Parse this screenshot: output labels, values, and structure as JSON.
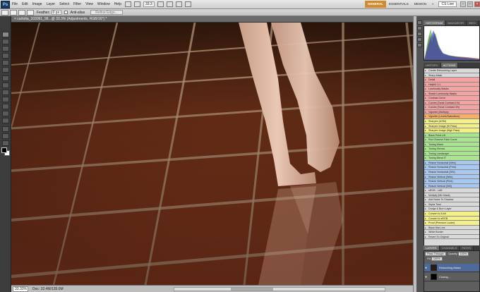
{
  "menubar": {
    "logo": "Ps",
    "items": [
      "File",
      "Edit",
      "Image",
      "Layer",
      "Select",
      "Filter",
      "View",
      "Window",
      "Help"
    ],
    "zoom": "33.3",
    "workspaces": [
      "ESSENTIALS",
      "DESIGN"
    ],
    "active_workspace": "GENERAL",
    "cs_live": "CS Live"
  },
  "options": {
    "feather_label": "Feather:",
    "feather_value": "0 px",
    "antialias_label": "Anti-alias",
    "refine_label": "Refine Edge..."
  },
  "document": {
    "tab_title": "× carlotta_103061_98...@ 33.3% (Adjustments, RGB/16*) *"
  },
  "status": {
    "zoom": "33.33%",
    "doc": "Doc: 32.4M/135.0M"
  },
  "histogram": {
    "tabs": [
      "HISTOGRAM",
      "NAVIGATOR",
      "INFO"
    ]
  },
  "actions": {
    "tabs": [
      "HISTORY",
      "ACTIONS"
    ],
    "items": [
      {
        "label": "Create Retouching Layer",
        "color": "#d9d9d9"
      },
      {
        "label": "Sharp Mask",
        "color": "#d9d9d9"
      },
      {
        "label": "Detail",
        "color": "#f4a3a3"
      },
      {
        "label": "Helpful 1:1",
        "color": "#f4a3a3"
      },
      {
        "label": "Luminosity Masks",
        "color": "#f4a3a3"
      },
      {
        "label": "Shade Luminosity Masks",
        "color": "#f4a3a3"
      },
      {
        "label": "Contrast Curve",
        "color": "#f4a3a3"
      },
      {
        "label": "Curves (Tonal Contrast 1%)",
        "color": "#f4a3a3"
      },
      {
        "label": "Curves (Tonal Contrast 4%)",
        "color": "#f4a3a3"
      },
      {
        "label": "Vignette (Multiply)",
        "color": "#f4a3a3"
      },
      {
        "label": "Vignette (Levels/Saturation)",
        "color": "#f4b06b"
      },
      {
        "label": "Sharpen (USM)",
        "color": "#f3f08a"
      },
      {
        "label": "Sharpen Image (Hi Pass)",
        "color": "#f3f08a"
      },
      {
        "label": "Sharpen Image (High Pass)",
        "color": "#f3f08a"
      },
      {
        "label": "Black Point Lift",
        "color": "#a9e58f"
      },
      {
        "label": "Red Channel Fake Curve",
        "color": "#a9e58f"
      },
      {
        "label": "Toning Warm",
        "color": "#a9e58f"
      },
      {
        "label": "Toning Sienna",
        "color": "#a9e58f"
      },
      {
        "label": "Toning Landscape",
        "color": "#a9e58f"
      },
      {
        "label": "Toning Blend IT",
        "color": "#a9e58f"
      },
      {
        "label": "Resize Horizontal (Web)",
        "color": "#a9c8ef"
      },
      {
        "label": "Resize Horizontal (Print)",
        "color": "#a9c8ef"
      },
      {
        "label": "Resize Horizontal (300)",
        "color": "#a9c8ef"
      },
      {
        "label": "Resize Vertical (Web)",
        "color": "#a9c8ef"
      },
      {
        "label": "Resize Vertical (Print)",
        "color": "#a9c8ef"
      },
      {
        "label": "Resize Vertical (300)",
        "color": "#a9c8ef"
      },
      {
        "label": "sRGB - LAB",
        "color": "#d9d9d9"
      },
      {
        "label": "Multiply (Mix Mask)",
        "color": "#d9d9d9"
      },
      {
        "label": "Add Noise To Shadow",
        "color": "#d9d9d9"
      },
      {
        "label": "Sepia Tone",
        "color": "#d9d9d9"
      },
      {
        "label": "Dodge & Burn Layer",
        "color": "#d9d9d9"
      },
      {
        "label": "Convert to 8-bit",
        "color": "#f3f08a"
      },
      {
        "label": "Convert to sRGB",
        "color": "#f3f08a"
      },
      {
        "label": "Proof (Premium Luster)",
        "color": "#f3f08a"
      },
      {
        "label": "Black Mat Line",
        "color": "#d9d9d9"
      },
      {
        "label": "White Border",
        "color": "#d9d9d9"
      },
      {
        "label": "Revert To Original",
        "color": "#d9d9d9"
      }
    ]
  },
  "layers": {
    "tabs": [
      "LAYERS",
      "CHANNELS",
      "PATHS"
    ],
    "blend_mode": "Pass Through",
    "opacity_label": "Opacity:",
    "opacity_value": "100%",
    "fill_label": "Fill:",
    "fill_value": "100%",
    "rows": [
      {
        "name": "Retouching Attack",
        "thumb": "#2b1a12"
      },
      {
        "name": "Closing...",
        "thumb": "#000000"
      }
    ]
  }
}
